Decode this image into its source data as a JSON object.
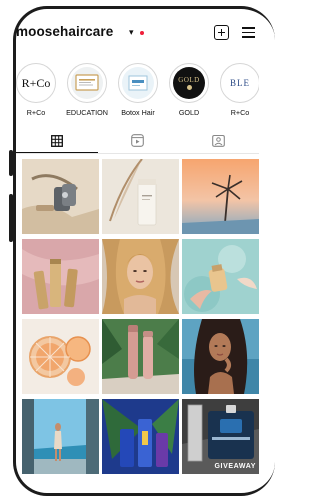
{
  "profile": {
    "username": "moosehaircare"
  },
  "highlights": [
    {
      "label": "R+Co",
      "badge": "R+Co"
    },
    {
      "label": "EDUCATION"
    },
    {
      "label": "Botox Hair"
    },
    {
      "label": "GOLD",
      "badge": "GOLD"
    },
    {
      "label": "R+Co",
      "badge": "BLE"
    }
  ],
  "tabs": [
    {
      "name": "grid",
      "icon": "grid-icon"
    },
    {
      "name": "reels",
      "icon": "reels-icon"
    },
    {
      "name": "tagged",
      "icon": "tagged-icon"
    }
  ],
  "posts": [
    {
      "overlay": ""
    },
    {
      "overlay": ""
    },
    {
      "overlay": ""
    },
    {
      "overlay": ""
    },
    {
      "overlay": ""
    },
    {
      "overlay": ""
    },
    {
      "overlay": ""
    },
    {
      "overlay": ""
    },
    {
      "overlay": ""
    },
    {
      "overlay": ""
    },
    {
      "overlay": ""
    },
    {
      "overlay": "GIVEAWAY"
    }
  ],
  "colors": {
    "accent_dot": "#ef1f3a",
    "text": "#111111"
  }
}
